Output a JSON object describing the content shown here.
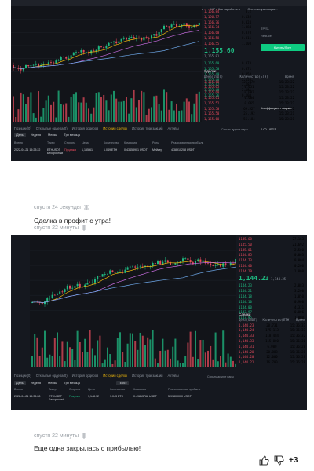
{
  "post1": {
    "bookmarks": [
      "Заявления о прогр...",
      "Рекомендации",
      "Ресурсы для инве...",
      "Инструменты для П...",
      "О себе",
      "Александр Нованов",
      "МР - Как заработать",
      "Система умеющая...",
      "Александр Нованов",
      "ОБО для..."
    ],
    "panel_tabs": [
      "Фьюч Бит",
      "Futures Tr.",
      "Вверх"
    ],
    "orderbook": {
      "asks": [
        [
          "1,156.84",
          "0.2"
        ],
        [
          "1,156.77",
          "0.135"
        ],
        [
          "1,156.76",
          "0.024"
        ],
        [
          "1,156.74",
          "1.084"
        ],
        [
          "1,156.60",
          "0.070"
        ],
        [
          "1,156.58",
          "0.011"
        ],
        [
          "1,156.55",
          "1.100"
        ]
      ],
      "last_price": "1,155.60",
      "last_price_sub": "1,155.81",
      "bids": [
        [
          "1,155.60",
          "0.073"
        ],
        [
          "1,155.50",
          "0.071"
        ],
        [
          "1,155.49",
          "0.050"
        ],
        [
          "1,155.48",
          "2.155"
        ],
        [
          "1,155.42",
          "2.187"
        ],
        [
          "1,155.40",
          "2.181"
        ],
        [
          "1,155.26",
          "0.100"
        ]
      ]
    },
    "trades": {
      "title": "Сделки",
      "headers": [
        "Цена(USDT)",
        "Количество(ETH)",
        "Время"
      ],
      "rows": [
        [
          "1,155.60",
          "21.870",
          "15:23:22"
        ],
        [
          "1,155.65",
          "0.051",
          "15:23:22"
        ],
        [
          "1,155.60",
          "0.002",
          "15:23:22"
        ],
        [
          "1,155.61",
          "0.004",
          "15:23:22"
        ],
        [
          "1,155.52",
          "0.065",
          "15:23:22"
        ],
        [
          "1,155.50",
          "69.527",
          "15:23:22"
        ],
        [
          "1,155.50",
          "25.192",
          "15:23:21"
        ],
        [
          "1,155.60",
          "56.184",
          "15:23:21"
        ]
      ]
    },
    "right_panel": {
      "tp_sl": "TP/SL",
      "reduce": "Reduce",
      "buy_button": "Купить/Лонг",
      "margin": "Коэффициент маржи",
      "balance": "0.00 USDT",
      "assets": "Активы"
    },
    "bottom_tabs": [
      "Позиции(0)",
      "Открытые ордера(0)",
      "История ордеров",
      "История сделок",
      "История транзакций",
      "Активы"
    ],
    "active_tab": "История сделок",
    "filter_buttons": [
      "День",
      "Неделя",
      "Месяц",
      "Три месяца"
    ],
    "hide_pairs": "Скрыть другие пары",
    "history_headers": [
      "Время",
      "Тикер",
      "Сторона",
      "Цена",
      "Количество",
      "Комиссия",
      "Роль",
      "Реализованная прибыль"
    ],
    "history_row": [
      "2022-04-21 15:23:22",
      "ETHUSDT\nБессрочный",
      "Продажа",
      "1,155.61",
      "1.049 ETH",
      "0.43453901 USDT",
      "Мейкер",
      "4.38910208 USDT"
    ]
  },
  "msg1": {
    "time": "спустя 24 секунды",
    "text": "Сделка в профит с утра!"
  },
  "meta2": {
    "time": "спустя 22 минуты"
  },
  "post2": {
    "chart_header": [
      "Время",
      "1ч",
      "4ч",
      "1Д",
      "Глубина",
      "Trading View"
    ],
    "price_labels": [
      "1144.23",
      "1145.22",
      "1137.45"
    ],
    "orderbook": {
      "asks": [
        [
          "1145.68",
          "27.163"
        ],
        [
          "1145.50",
          "21.692"
        ],
        [
          "1145.01",
          "2.500"
        ],
        [
          "1144.85",
          "0.063"
        ],
        [
          "1144.73",
          "0.004"
        ],
        [
          "1144.40",
          "0.260"
        ],
        [
          "1144.29",
          "1.000"
        ]
      ],
      "last_price": "1,144.23",
      "last_price_sub": "1,144.35",
      "bids": [
        [
          "1144.23",
          "2.083"
        ],
        [
          "1144.21",
          "3.200"
        ],
        [
          "1144.18",
          "1.050"
        ],
        [
          "1144.10",
          "0.900"
        ],
        [
          "1144.00",
          "4.331"
        ],
        [
          "1143.97",
          "0.006"
        ],
        [
          "1143.95",
          "1.000"
        ]
      ]
    },
    "trades": {
      "title": "Сделки",
      "headers": [
        "Цена(USDT)",
        "Количество(ETH)",
        "Время"
      ],
      "rows": [
        [
          "1,144.23",
          "20.731",
          "15:36:33"
        ],
        [
          "1,144.24",
          "175.113",
          "15:36:33"
        ],
        [
          "1,144.33",
          "118.484",
          "15:36:32"
        ],
        [
          "1,144.33",
          "115.000",
          "15:36:30"
        ],
        [
          "1,144.31",
          "6.000",
          "15:36:28"
        ],
        [
          "1,144.20",
          "20.888",
          "15:36:28"
        ],
        [
          "1,144.20",
          "12.000",
          "15:36:28"
        ],
        [
          "1,144.21",
          "16.700",
          "15:36:28"
        ]
      ]
    },
    "bottom_tabs": [
      "Позиции(0)",
      "Открытые ордера(0)",
      "История ордеров",
      "История сделок",
      "История транзакций",
      "Активы"
    ],
    "active_tab": "История сделок",
    "filter_buttons": [
      "День",
      "Неделя",
      "Месяц",
      "Три месяца"
    ],
    "search_button": "Поиск",
    "hide_pairs": "Скрыть другие пары",
    "history_headers": [
      "Время",
      "Тикер",
      "Сторона",
      "Цена",
      "Количество",
      "Комиссия",
      "Реализованная прибыль"
    ],
    "history_row": [
      "2022-04-21 15:36:28",
      "ETHUSDT\nБессрочный",
      "Покупка",
      "1,148.12",
      "1.043 ETH",
      "0.49813768 USDT",
      "5.99800000 USDT"
    ]
  },
  "msg2": {
    "time": "спустя 22 минуты",
    "text": "Еще одна закрылась с прибылью!"
  },
  "reactions": {
    "count": "+3"
  },
  "colors": {
    "up": "#1fb981",
    "down": "#e2495b",
    "accent": "#f0b90b",
    "bg": "#15181f"
  }
}
